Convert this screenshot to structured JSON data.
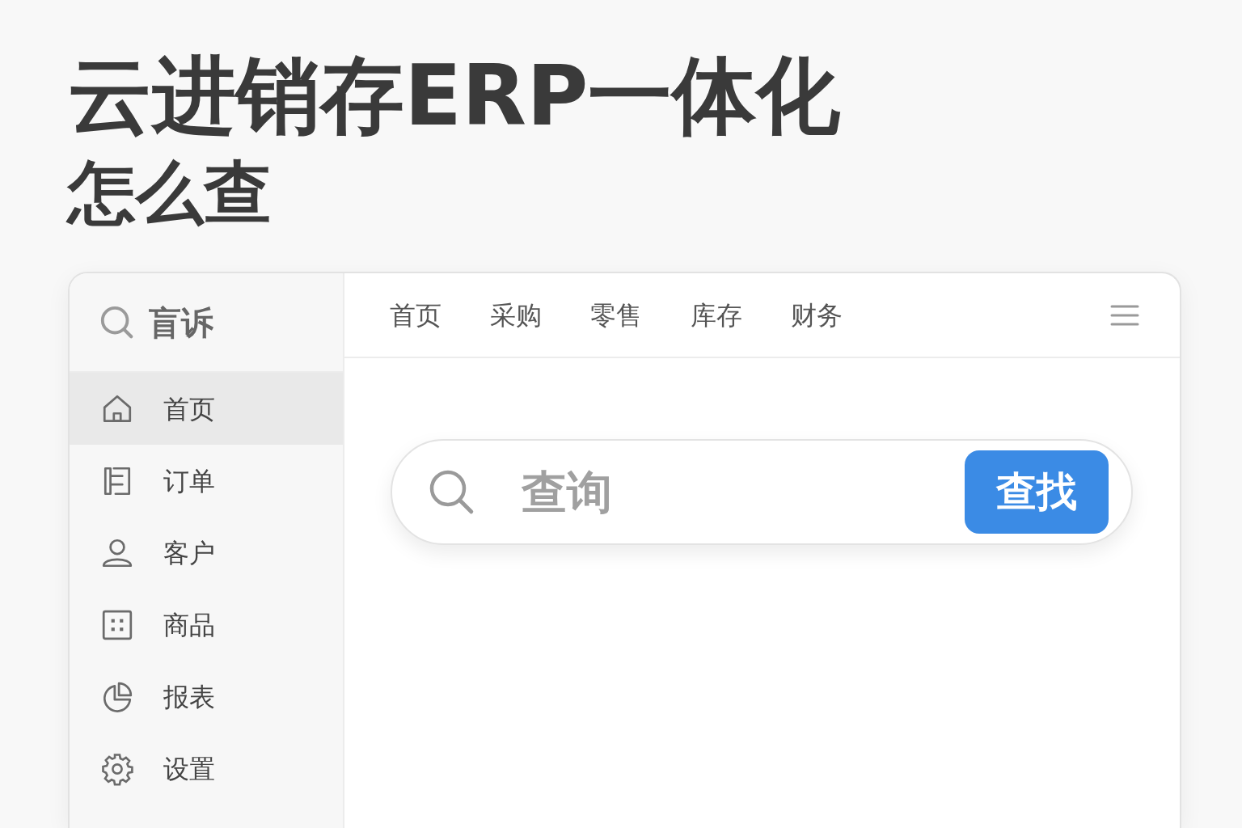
{
  "headline": "云进销存ERP一体化",
  "subheadline": "怎么查",
  "sidebar": {
    "search_label": "盲诉",
    "items": [
      {
        "label": "首页",
        "kind": "home",
        "selected": true
      },
      {
        "label": "订单",
        "kind": "order",
        "selected": false
      },
      {
        "label": "客户",
        "kind": "user",
        "selected": false
      },
      {
        "label": "商品",
        "kind": "grid",
        "selected": false
      },
      {
        "label": "报表",
        "kind": "pie",
        "selected": false
      },
      {
        "label": "设置",
        "kind": "gear",
        "selected": false
      }
    ]
  },
  "top_nav": [
    "首页",
    "采购",
    "零售",
    "库存",
    "财务"
  ],
  "search": {
    "placeholder": "查询",
    "button": "查找"
  }
}
